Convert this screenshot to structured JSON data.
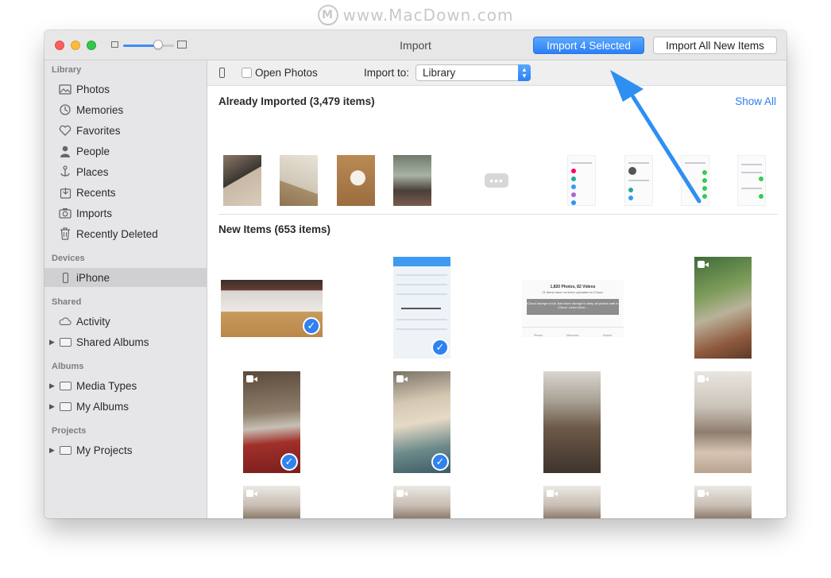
{
  "watermark": {
    "logo": "M",
    "text": "www.MacDown.com"
  },
  "window": {
    "title": "Import",
    "zoom_level": 0.68,
    "buttons": {
      "import_selected": "Import 4 Selected",
      "import_all": "Import All New Items"
    }
  },
  "sidebar": {
    "sections": {
      "library": "Library",
      "devices": "Devices",
      "shared": "Shared",
      "albums": "Albums",
      "projects": "Projects"
    },
    "library_items": [
      {
        "label": "Photos",
        "icon": "photos-icon"
      },
      {
        "label": "Memories",
        "icon": "memories-icon"
      },
      {
        "label": "Favorites",
        "icon": "heart-icon"
      },
      {
        "label": "People",
        "icon": "person-icon"
      },
      {
        "label": "Places",
        "icon": "pin-icon"
      },
      {
        "label": "Recents",
        "icon": "recents-icon"
      },
      {
        "label": "Imports",
        "icon": "camera-icon"
      },
      {
        "label": "Recently Deleted",
        "icon": "trash-icon"
      }
    ],
    "device_items": [
      {
        "label": "iPhone",
        "icon": "iphone-icon",
        "selected": true
      }
    ],
    "shared_items": [
      {
        "label": "Activity",
        "icon": "cloud-icon"
      },
      {
        "label": "Shared Albums",
        "icon": "folder-icon"
      }
    ],
    "album_items": [
      {
        "label": "Media Types",
        "icon": "folder-icon"
      },
      {
        "label": "My Albums",
        "icon": "folder-icon"
      }
    ],
    "project_items": [
      {
        "label": "My Projects",
        "icon": "folder-icon"
      }
    ]
  },
  "toolbar": {
    "open_photos_label": "Open Photos",
    "open_photos_checked": false,
    "import_to_label": "Import to:",
    "import_to_value": "Library"
  },
  "already_imported": {
    "heading": "Already Imported (3,479 items)",
    "show_all": "Show All"
  },
  "new_items": {
    "heading": "New Items (653 items)",
    "screenshot_text": {
      "line1": "1,820 Photos, 82 Videos",
      "line2": "21 items have not been uploaded to iCloud.",
      "banner": "iCloud storage is full. Add more storage to keep all photos safe in iCloud. Learn More...",
      "tabs": [
        "Photos",
        "Memories",
        "Shared"
      ]
    },
    "checked_count": 4
  },
  "colors": {
    "accent": "#2f82f0",
    "arrow": "#2e8ff2"
  }
}
